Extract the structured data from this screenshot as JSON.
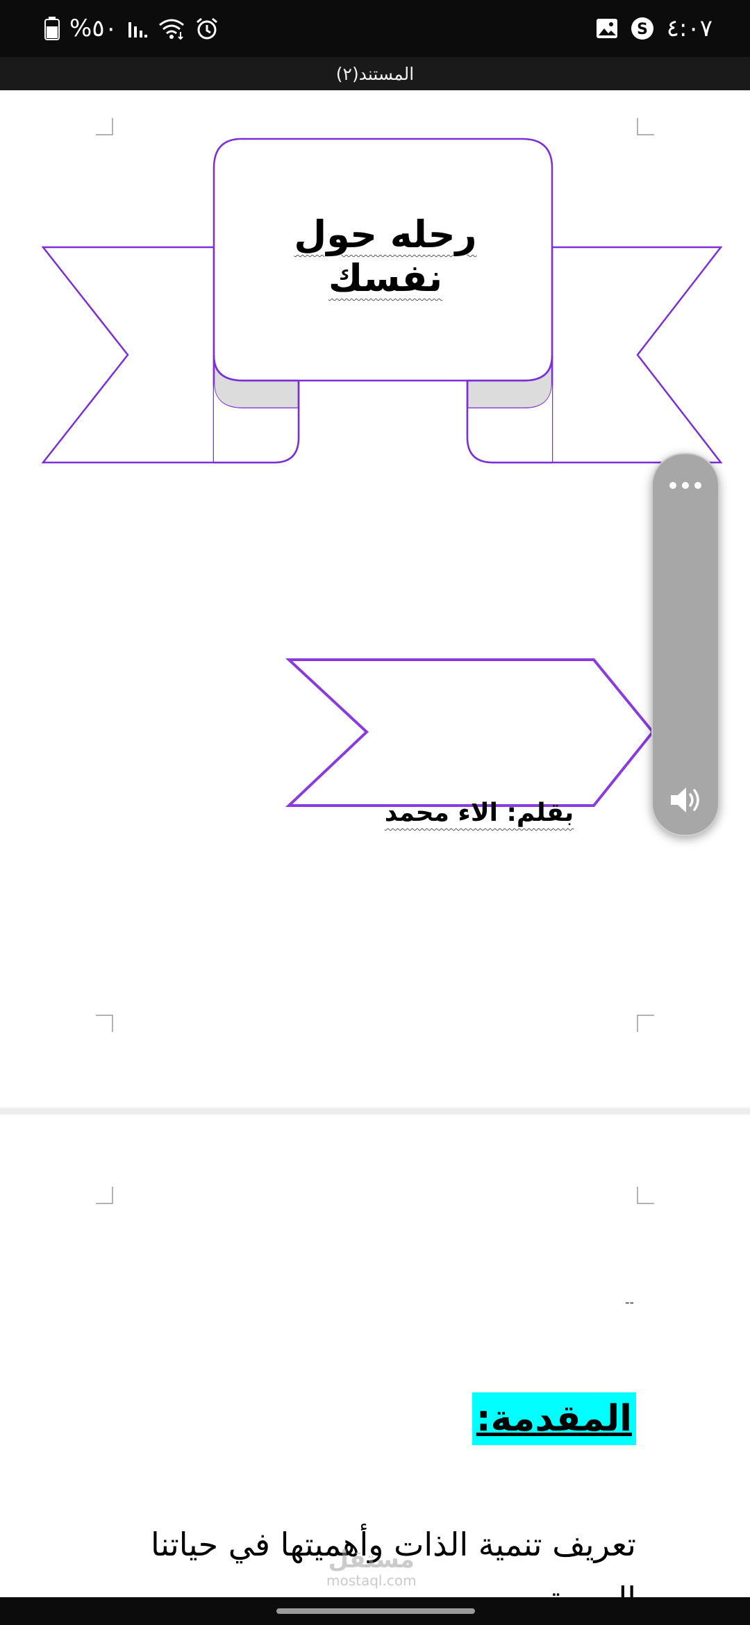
{
  "status_bar": {
    "time": "٤:٠٧",
    "battery": "%٥٠",
    "colors": {
      "background": "#0c0c0c",
      "text": "#ffffff"
    },
    "icons": [
      "battery-icon",
      "signal-icon",
      "wifi-icon",
      "alarm-icon",
      "gallery-icon",
      "s-app-icon"
    ]
  },
  "document": {
    "title": "المستند(٢)"
  },
  "page1": {
    "banner_title": "رحله حول نفسك",
    "author_line": "بقلم:  الاء محمد",
    "accent_color": "#7b2fd6"
  },
  "page2": {
    "dash": "--",
    "heading": "المقدمة:",
    "heading_highlight": "#00ffff",
    "paragraph": "تعريف تنمية الذات وأهميتها في حياتنا اليومية"
  },
  "volume_panel": {
    "icons": [
      "more-options-icon",
      "speaker-icon"
    ]
  },
  "watermark": {
    "arabic": "مستقل",
    "latin": "mostaql.com"
  }
}
